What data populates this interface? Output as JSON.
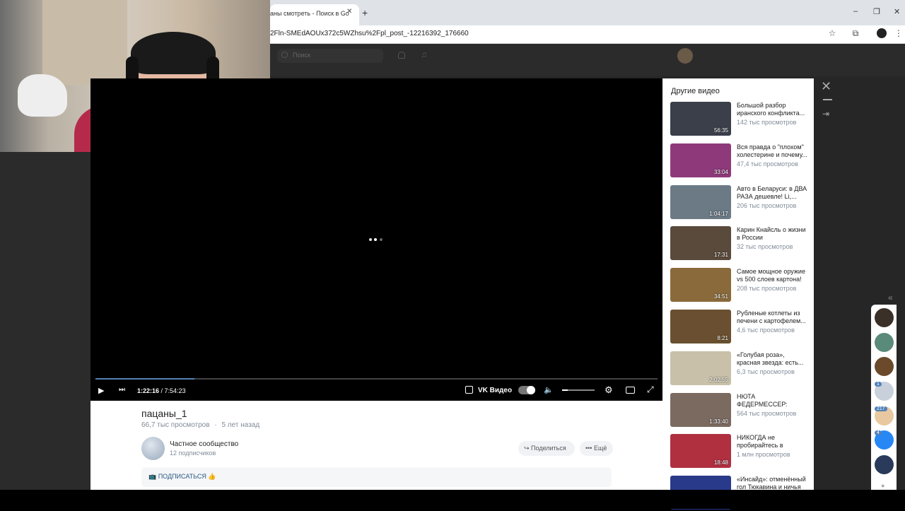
{
  "browser": {
    "tab_title": "аны смотреть - Поиск в Go",
    "tab_close": "✕",
    "new_tab": "+",
    "url": "2Fln-SMEdAOUx372c5WZhsu%2Fpl_post_-12216392_176660",
    "window_minimize": "–",
    "window_restore": "❐",
    "window_close": "✕"
  },
  "vk_header": {
    "search_placeholder": "Поиск"
  },
  "player": {
    "time_current": "1:22:16",
    "time_total": "7:54:23",
    "time_sep": " / ",
    "brand": "VK Видео",
    "progress_fraction": 0.176
  },
  "video_info": {
    "title": "пацаны_1",
    "views": "66,7 тыс просмотров",
    "dot": "·",
    "age": "5 лет назад",
    "community_name": "Частное сообщество",
    "community_subs": "12 подписчиков",
    "share_label": "Поделиться",
    "more_label": "Ещё",
    "subscribe_label": "📺 ПОДПИСАТЬСЯ 👍"
  },
  "sidebar": {
    "title": "Другие видео",
    "videos": [
      {
        "title": "Большой разбор иранского конфликта...",
        "views": "142 тыс просмотров",
        "duration": "56:35",
        "color": "#3a3f4a"
      },
      {
        "title": "Вся правда о \"плохом\" холестерине и почему...",
        "views": "47,4 тыс просмотров",
        "duration": "33:04",
        "color": "#8e3a7a"
      },
      {
        "title": "Авто в Беларуси: в ДВА РАЗА дешевле! Li,...",
        "views": "206 тыс просмотров",
        "duration": "1:04:17",
        "color": "#6c7a86"
      },
      {
        "title": "Карин Кнайсль о жизни в России",
        "views": "32 тыс просмотров",
        "duration": "17:31",
        "color": "#5a4a3c"
      },
      {
        "title": "Самое мощное оружие vs 500 слоев картона!",
        "views": "208 тыс просмотров",
        "duration": "34:51",
        "color": "#8a6a3a"
      },
      {
        "title": "Рубленые котлеты из печени с картофелем...",
        "views": "4,6 тыс просмотров",
        "duration": "8:21",
        "color": "#6a5030"
      },
      {
        "title": "«Голубая роза», красная звезда: есть...",
        "views": "6,3 тыс просмотров",
        "duration": "2:02:55",
        "color": "#c8c0a8"
      },
      {
        "title": "НЮТА ФЕДЕРМЕССЕР: «Псевдогуманизм —...",
        "views": "564 тыс просмотров",
        "duration": "1:33:40",
        "color": "#7a6a60"
      },
      {
        "title": "НИКОГДА не пробирайтесь в ШКОЛ...",
        "views": "1 млн просмотров",
        "duration": "18:48",
        "color": "#b03040"
      },
      {
        "title": "«Инсайд»: отменённый гол Тюкавина и ничья ...",
        "views": "",
        "duration": "",
        "color": "#2a3a8a"
      }
    ]
  },
  "right_panel": {
    "close": "✕",
    "dock": "⇥",
    "collapse": "«"
  },
  "chats": {
    "badge_1": "1",
    "badge_2": "217",
    "badge_3": "4"
  }
}
